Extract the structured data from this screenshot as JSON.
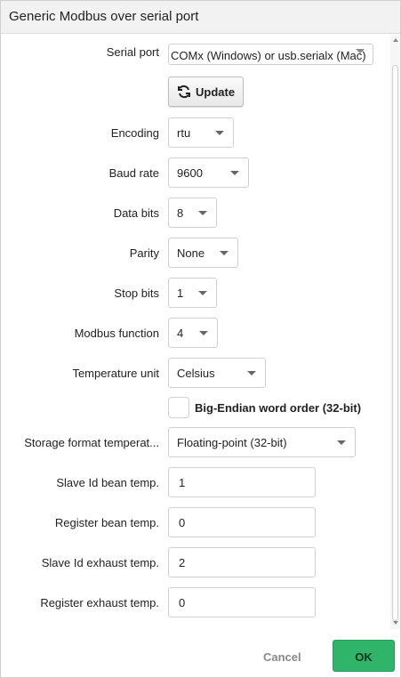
{
  "dialog": {
    "title": "Generic Modbus over serial port"
  },
  "fields": {
    "serial_port": {
      "label": "Serial port",
      "value": "COMx (Windows) or usb.serialx (Mac)"
    },
    "update_button": "Update",
    "encoding": {
      "label": "Encoding",
      "value": "rtu"
    },
    "baud_rate": {
      "label": "Baud rate",
      "value": "9600"
    },
    "data_bits": {
      "label": "Data bits",
      "value": "8"
    },
    "parity": {
      "label": "Parity",
      "value": "None"
    },
    "stop_bits": {
      "label": "Stop bits",
      "value": "1"
    },
    "modbus_function": {
      "label": "Modbus function",
      "value": "4"
    },
    "temperature_unit": {
      "label": "Temperature unit",
      "value": "Celsius"
    },
    "big_endian": {
      "label": "Big-Endian word order (32-bit)",
      "checked": false
    },
    "storage_format": {
      "label": "Storage format temperat...",
      "value": "Floating-point (32-bit)"
    },
    "slave_id_bean": {
      "label": "Slave Id bean temp.",
      "value": "1"
    },
    "register_bean": {
      "label": "Register bean temp.",
      "value": "0"
    },
    "slave_id_exhaust": {
      "label": "Slave Id exhaust temp.",
      "value": "2"
    },
    "register_exhaust": {
      "label": "Register exhaust temp.",
      "value": "0"
    }
  },
  "footer": {
    "cancel_label": "Cancel",
    "ok_label": "OK"
  },
  "colors": {
    "ok_button": "#2fb46a",
    "cancel_text": "#888888",
    "titlebar_bg": "#f2f2f2"
  },
  "icons": {
    "update": "refresh-icon",
    "dropdown": "caret-down-icon"
  }
}
